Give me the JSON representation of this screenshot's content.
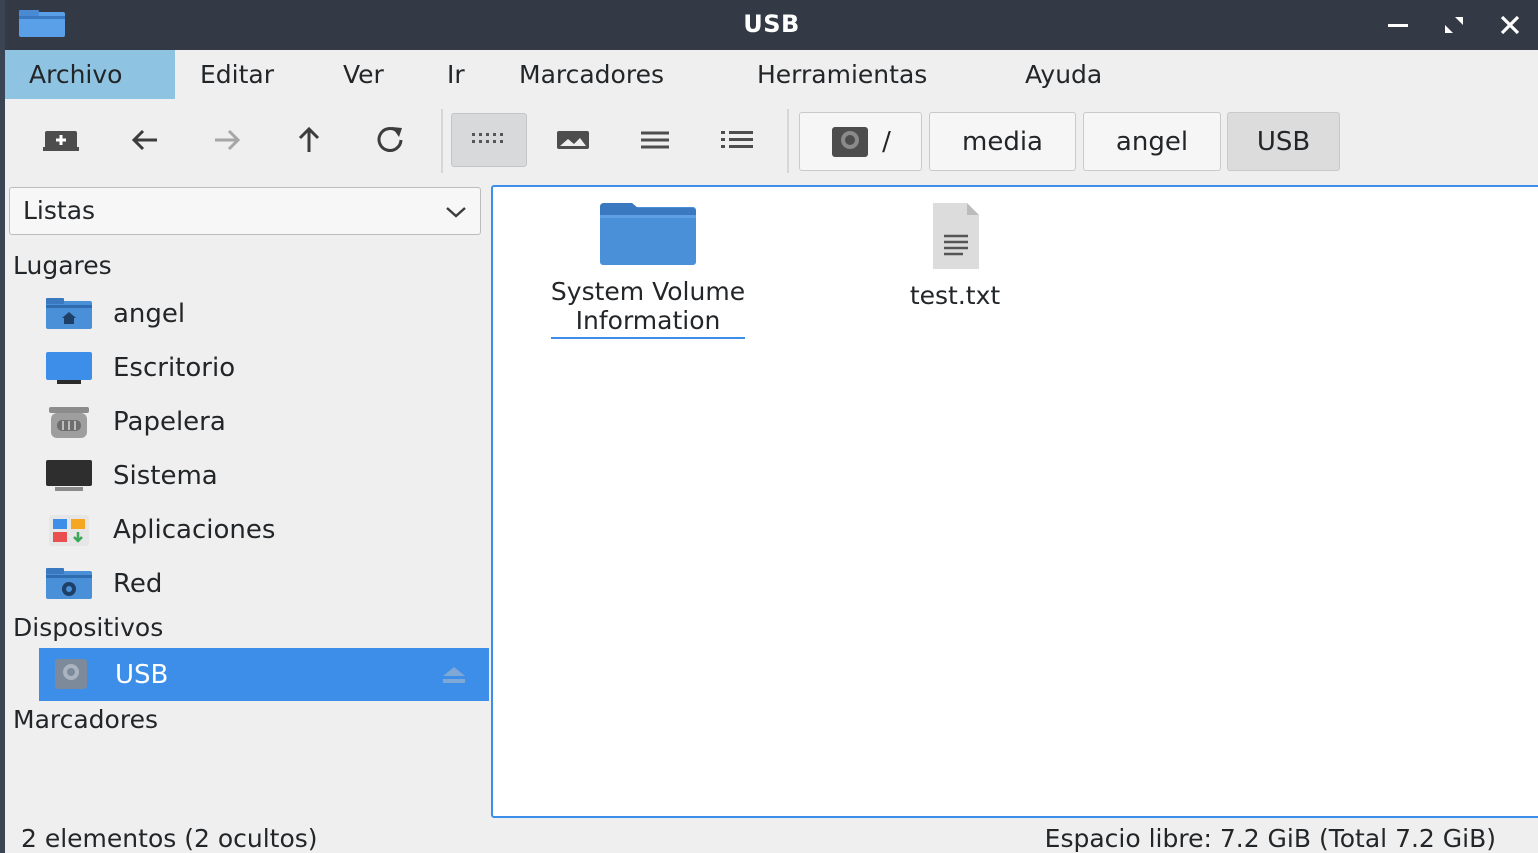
{
  "window": {
    "title": "USB"
  },
  "menubar": {
    "items": [
      {
        "label": "Archivo"
      },
      {
        "label": "Editar"
      },
      {
        "label": "Ver"
      },
      {
        "label": "Ir"
      },
      {
        "label": "Marcadores"
      },
      {
        "label": "Herramientas"
      },
      {
        "label": "Ayuda"
      }
    ]
  },
  "breadcrumb": {
    "root_label": "/",
    "segments": [
      {
        "label": "media"
      },
      {
        "label": "angel"
      },
      {
        "label": "USB"
      }
    ]
  },
  "sidebar": {
    "combo_value": "Listas",
    "sections": {
      "places": "Lugares",
      "devices": "Dispositivos",
      "bookmarks": "Marcadores"
    },
    "places": [
      {
        "label": "angel",
        "icon": "home-folder-icon"
      },
      {
        "label": "Escritorio",
        "icon": "desktop-icon"
      },
      {
        "label": "Papelera",
        "icon": "trash-icon"
      },
      {
        "label": "Sistema",
        "icon": "computer-icon"
      },
      {
        "label": "Aplicaciones",
        "icon": "applications-icon"
      },
      {
        "label": "Red",
        "icon": "network-folder-icon"
      }
    ],
    "devices": [
      {
        "label": "USB",
        "icon": "drive-icon",
        "selected": true
      }
    ]
  },
  "files": [
    {
      "name_line1": "System Volume",
      "name_line2": "Information",
      "type": "folder"
    },
    {
      "name_line1": "test.txt",
      "type": "text-file"
    }
  ],
  "status": {
    "left": "2 elementos (2 ocultos)",
    "right": "Espacio libre: 7.2 GiB (Total 7.2 GiB)"
  },
  "colors": {
    "accent": "#3d8ee8",
    "titlebar": "#343a45",
    "menu_active": "#8ec3e2",
    "folder": "#4a90d9"
  }
}
